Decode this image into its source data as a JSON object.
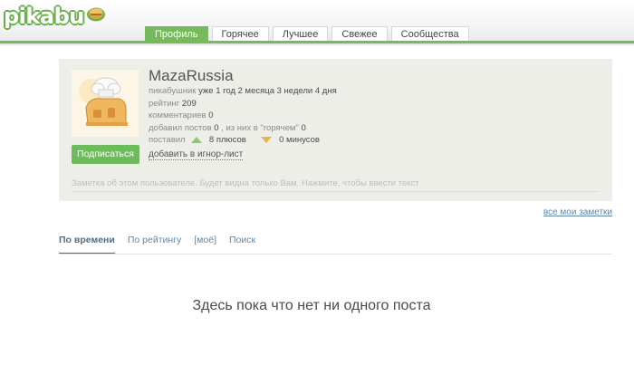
{
  "header": {
    "logo_text": "pikabu",
    "tabs": [
      {
        "label": "Профиль",
        "active": true
      },
      {
        "label": "Горячее",
        "active": false
      },
      {
        "label": "Лучшее",
        "active": false
      },
      {
        "label": "Свежее",
        "active": false
      },
      {
        "label": "Сообщества",
        "active": false
      }
    ],
    "accent_color": "#75bb5b"
  },
  "profile": {
    "username": "MazaRussia",
    "pikabushnik_label": "пикабушник",
    "pikabushnik_value": "уже 1 год 2 месяца 3 недели 4 дня",
    "rating_label": "рейтинг",
    "rating_value": "209",
    "comments_label": "комментариев",
    "comments_value": "0",
    "posts_label": "добавил постов",
    "posts_value": "0",
    "posts_hot_label": ", из них в \"горячем\"",
    "posts_hot_value": "0",
    "gave_label": "поставил",
    "pluses": "8 плюсов",
    "minuses": "0 минусов",
    "avatar_icon": "chef-house-icon",
    "subscribe_label": "Подписаться",
    "ignore_label": "добавить в игнор-лист",
    "note_placeholder": "Заметка об этом пользователе. Будет видна только Вам. Нажмите, чтобы ввести текст"
  },
  "all_notes_label": "все мои заметки",
  "sort_tabs": [
    {
      "label": "По времени",
      "active": true
    },
    {
      "label": "По рейтингу",
      "active": false
    },
    {
      "label": "[моё]",
      "active": false
    },
    {
      "label": "Поиск",
      "active": false
    }
  ],
  "empty_message": "Здесь пока что нет ни одного поста"
}
